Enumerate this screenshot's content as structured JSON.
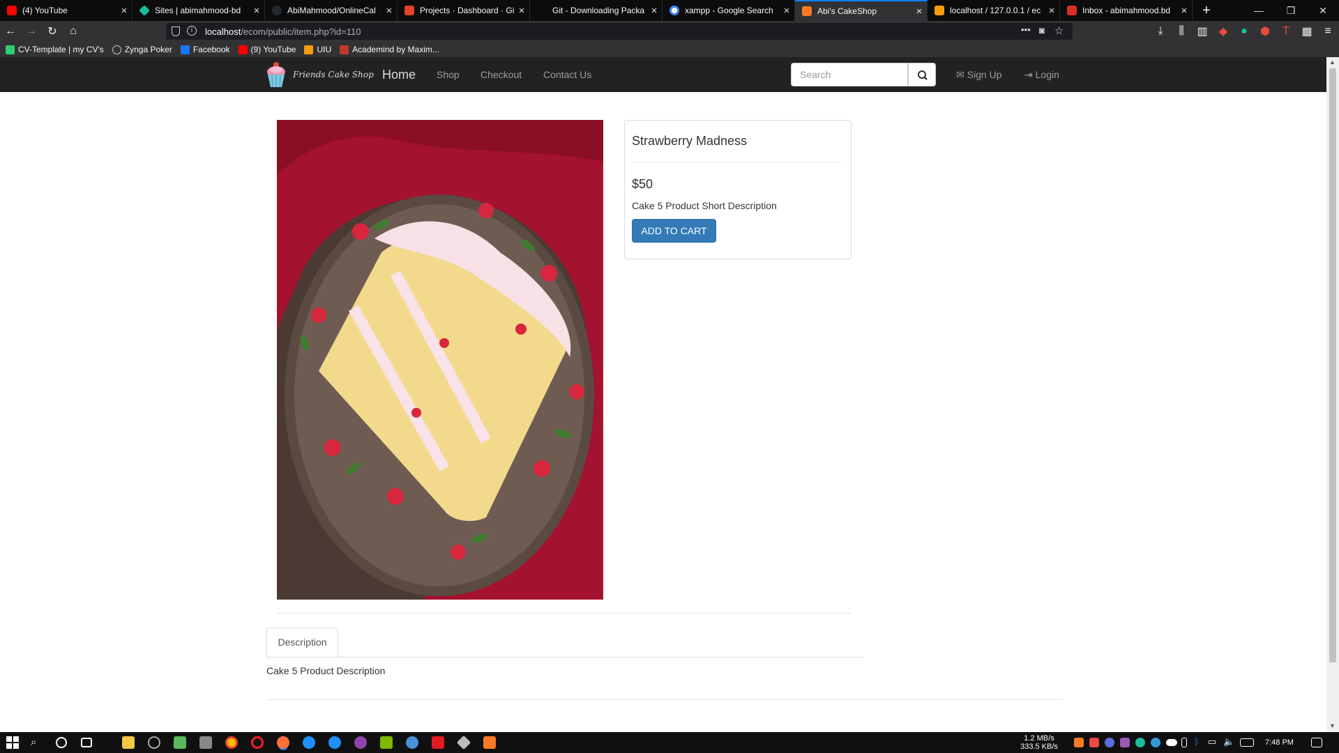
{
  "browser": {
    "tabs": [
      {
        "title": "(4) YouTube",
        "color": "#ff0000"
      },
      {
        "title": "Sites | abimahmood-bd",
        "color": "#1abc9c"
      },
      {
        "title": "AbiMahmood/OnlineCal",
        "color": "#24292e"
      },
      {
        "title": "Projects · Dashboard · Gi",
        "color": "#e24329"
      },
      {
        "title": "Git - Downloading Packa",
        "color": "#f05032"
      },
      {
        "title": "xampp - Google Search",
        "color": "#4285f4"
      },
      {
        "title": "Abi's CakeShop",
        "color": "#fb7a24",
        "active": true
      },
      {
        "title": "localhost / 127.0.0.1 / ec",
        "color": "#f89c0e"
      },
      {
        "title": "Inbox - abimahmood.bd",
        "color": "#d93025"
      }
    ],
    "url_host": "localhost",
    "url_path": "/ecom/public/item.php?id=110",
    "bookmarks": [
      {
        "label": "CV-Template | my CV's",
        "color": "#2ecc71"
      },
      {
        "label": "Zynga Poker",
        "color": "#cccccc"
      },
      {
        "label": "Facebook",
        "color": "#1877f2"
      },
      {
        "label": "(9) YouTube",
        "color": "#ff0000"
      },
      {
        "label": "UIU",
        "color": "#f39c12"
      },
      {
        "label": "Academind by Maxim...",
        "color": "#c0392b"
      }
    ]
  },
  "navbar": {
    "brand": "Friends Cake Shop",
    "home": "Home",
    "shop": "Shop",
    "checkout": "Checkout",
    "contact": "Contact Us",
    "search_placeholder": "Search",
    "signup": "Sign Up",
    "login": "Login"
  },
  "product": {
    "title": "Strawberry Madness",
    "price": "$50",
    "short_description": "Cake 5 Product Short Description",
    "add_to_cart": "ADD TO CART",
    "tab_label": "Description",
    "description": "Cake 5 Product Description"
  },
  "taskbar": {
    "net_down": "1.2 MB/s",
    "net_up": "333.5 KB/s",
    "time": "7:48 PM"
  },
  "colors": {
    "navbar_bg": "#222222",
    "button_primary": "#337ab7",
    "active_tab_accent": "#0a84ff"
  }
}
